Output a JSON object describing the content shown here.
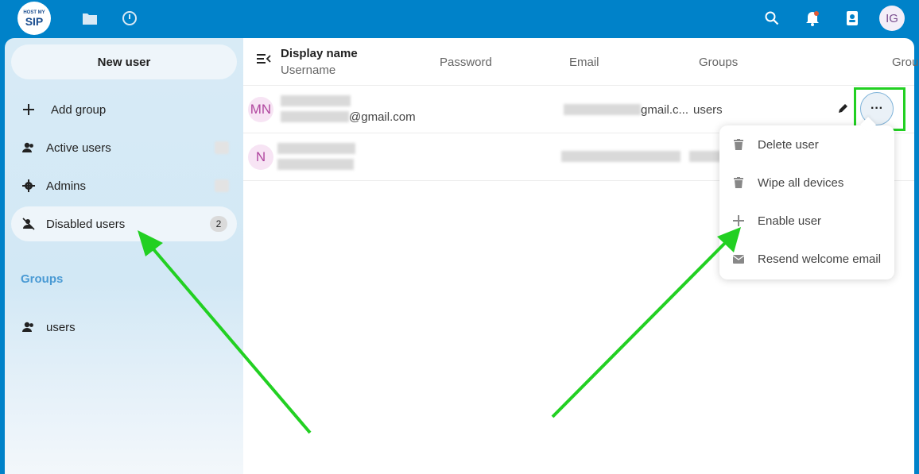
{
  "topbar": {
    "logo_top": "HOST MY",
    "logo_main": "SIP",
    "user_initials": "IG"
  },
  "sidebar": {
    "new_user_label": "New user",
    "add_group_label": "Add group",
    "items": [
      {
        "label": "Active users"
      },
      {
        "label": "Admins"
      },
      {
        "label": "Disabled users",
        "count": "2"
      }
    ],
    "groups_caption": "Groups",
    "groups": [
      {
        "label": "users"
      }
    ]
  },
  "table": {
    "headers": {
      "display_name": "Display name",
      "username": "Username",
      "password": "Password",
      "email": "Email",
      "groups": "Groups",
      "group_admin": "Grou"
    },
    "rows": [
      {
        "initials": "MN",
        "username_suffix": "@gmail.com",
        "email_suffix": "gmail.c...",
        "groups": "users"
      },
      {
        "initials": "N"
      }
    ]
  },
  "more_button_label": "···",
  "actions_menu": {
    "items": [
      {
        "label": "Delete user",
        "icon": "trash-icon"
      },
      {
        "label": "Wipe all devices",
        "icon": "trash-icon"
      },
      {
        "label": "Enable user",
        "icon": "plus-icon"
      },
      {
        "label": "Resend welcome email",
        "icon": "email-icon"
      }
    ]
  },
  "colors": {
    "header_blue": "#0082c9",
    "annotation_green": "#22d022"
  }
}
